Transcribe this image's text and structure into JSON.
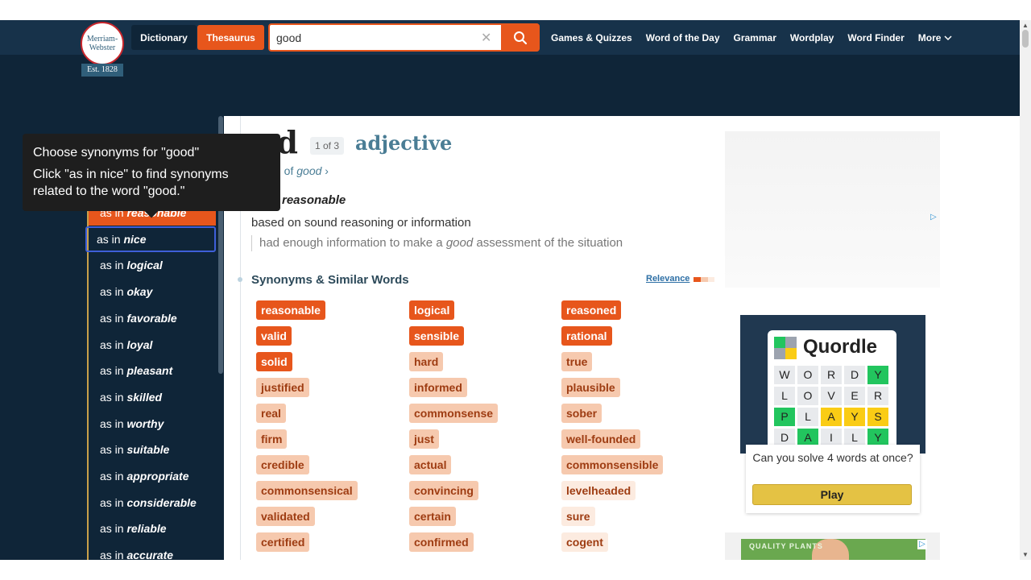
{
  "header": {
    "logo_line1": "Merriam-",
    "logo_line2": "Webster",
    "logo_est": "Est. 1828",
    "tab_dictionary": "Dictionary",
    "tab_thesaurus": "Thesaurus",
    "search_value": "good",
    "nav_links": [
      "Games & Quizzes",
      "Word of the Day",
      "Grammar",
      "Wordplay",
      "Word Finder",
      "More"
    ]
  },
  "tooltip": {
    "line1": "Choose synonyms for \"good\"",
    "line2": "Click \"as in nice\" to find synonyms related to the word \"good.\""
  },
  "sidebar": {
    "prefix": "as in",
    "items": [
      {
        "word": "reasonable",
        "state": "active"
      },
      {
        "word": "nice",
        "state": "highlighted"
      },
      {
        "word": "logical",
        "state": "normal"
      },
      {
        "word": "okay",
        "state": "normal"
      },
      {
        "word": "favorable",
        "state": "normal"
      },
      {
        "word": "loyal",
        "state": "normal"
      },
      {
        "word": "pleasant",
        "state": "normal"
      },
      {
        "word": "skilled",
        "state": "normal"
      },
      {
        "word": "worthy",
        "state": "normal"
      },
      {
        "word": "suitable",
        "state": "normal"
      },
      {
        "word": "appropriate",
        "state": "normal"
      },
      {
        "word": "considerable",
        "state": "normal"
      },
      {
        "word": "reliable",
        "state": "normal"
      },
      {
        "word": "accurate",
        "state": "normal"
      }
    ]
  },
  "entry": {
    "headword_visible": "od",
    "count": "1 of 3",
    "pos": "adjective",
    "definition_link_prefix": "n of",
    "definition_link_word": "good",
    "definition_link_suffix": "›",
    "sense": "reasonable",
    "definition": "based on sound reasoning or information",
    "example_pre": "had enough information to make a",
    "example_word": "good",
    "example_post": "assessment of the situation",
    "synonyms_heading": "Synonyms & Similar Words",
    "relevance_label": "Relevance"
  },
  "synonyms": {
    "col1": [
      {
        "w": "reasonable",
        "r": "strong"
      },
      {
        "w": "valid",
        "r": "strong"
      },
      {
        "w": "solid",
        "r": "strong"
      },
      {
        "w": "justified",
        "r": "medium"
      },
      {
        "w": "real",
        "r": "medium"
      },
      {
        "w": "firm",
        "r": "medium"
      },
      {
        "w": "credible",
        "r": "medium"
      },
      {
        "w": "commonsensical",
        "r": "medium"
      },
      {
        "w": "validated",
        "r": "medium"
      },
      {
        "w": "certified",
        "r": "medium"
      }
    ],
    "col2": [
      {
        "w": "logical",
        "r": "strong"
      },
      {
        "w": "sensible",
        "r": "strong"
      },
      {
        "w": "hard",
        "r": "medium"
      },
      {
        "w": "informed",
        "r": "medium"
      },
      {
        "w": "commonsense",
        "r": "medium"
      },
      {
        "w": "just",
        "r": "medium"
      },
      {
        "w": "actual",
        "r": "medium"
      },
      {
        "w": "convincing",
        "r": "medium"
      },
      {
        "w": "certain",
        "r": "medium"
      },
      {
        "w": "confirmed",
        "r": "medium"
      }
    ],
    "col3": [
      {
        "w": "reasoned",
        "r": "strong"
      },
      {
        "w": "rational",
        "r": "strong"
      },
      {
        "w": "true",
        "r": "medium"
      },
      {
        "w": "plausible",
        "r": "medium"
      },
      {
        "w": "sober",
        "r": "medium"
      },
      {
        "w": "well-founded",
        "r": "medium"
      },
      {
        "w": "commonsensible",
        "r": "medium"
      },
      {
        "w": "levelheaded",
        "r": "weak"
      },
      {
        "w": "sure",
        "r": "weak"
      },
      {
        "w": "cogent",
        "r": "weak"
      }
    ]
  },
  "quordle_ad": {
    "title": "Quordle",
    "rows": [
      [
        [
          "W",
          ""
        ],
        [
          "O",
          ""
        ],
        [
          "R",
          ""
        ],
        [
          "D",
          ""
        ],
        [
          "Y",
          "g"
        ]
      ],
      [
        [
          "L",
          ""
        ],
        [
          "O",
          ""
        ],
        [
          "V",
          ""
        ],
        [
          "E",
          ""
        ],
        [
          "R",
          ""
        ]
      ],
      [
        [
          "P",
          "g"
        ],
        [
          "L",
          ""
        ],
        [
          "A",
          "y"
        ],
        [
          "Y",
          "y"
        ],
        [
          "S",
          "y"
        ]
      ],
      [
        [
          "D",
          ""
        ],
        [
          "A",
          "g"
        ],
        [
          "I",
          ""
        ],
        [
          "L",
          ""
        ],
        [
          "Y",
          "g"
        ]
      ]
    ],
    "question": "Can you solve 4 words at once?",
    "play_label": "Play"
  },
  "ad2_text": "QUALITY PLANTS",
  "colors": {
    "brand_navy": "#17324a",
    "accent_orange": "#e7561c",
    "sidebar_bg": "#0f2538",
    "highlight_border": "#3e5fd8"
  }
}
